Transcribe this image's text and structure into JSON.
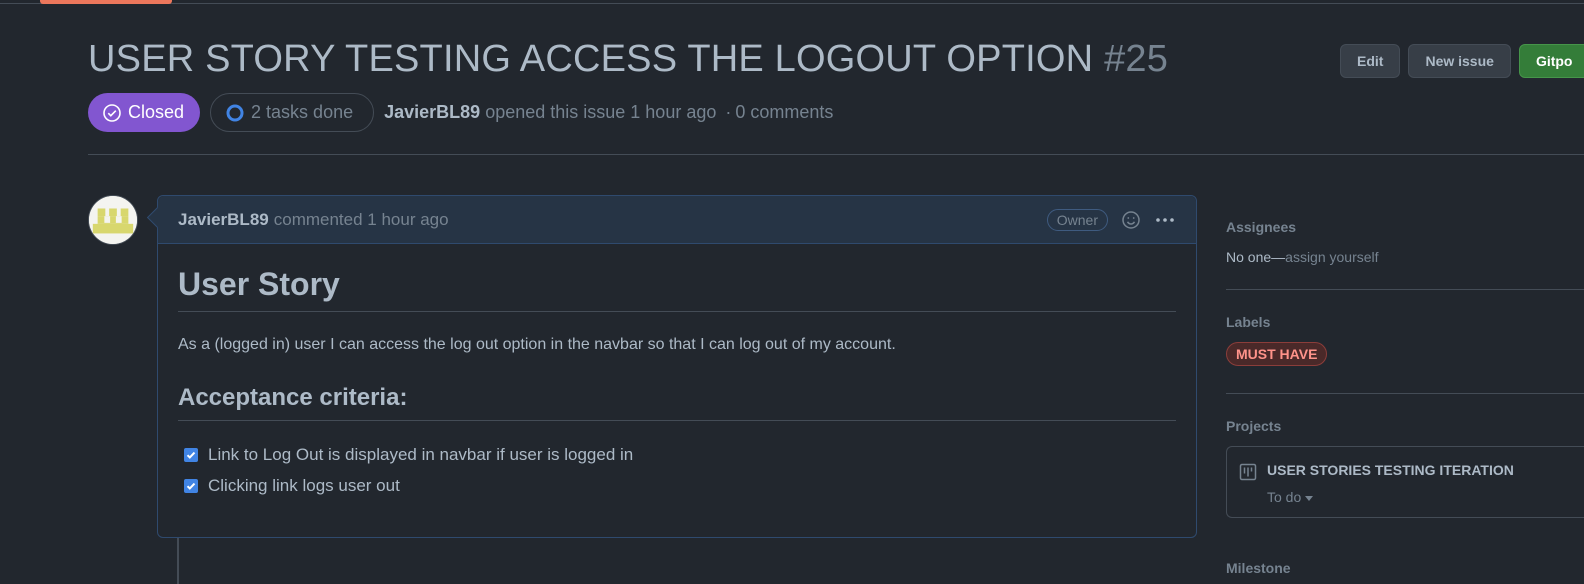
{
  "issue": {
    "title": "USER STORY TESTING ACCESS THE LOGOUT OPTION",
    "number": "#25",
    "state": "Closed",
    "tasks": "2 tasks done",
    "author": "JavierBL89",
    "opened_text": "opened this issue 1 hour ago",
    "separator": "·",
    "comments": "0 comments"
  },
  "header_actions": {
    "edit": "Edit",
    "new_issue": "New issue",
    "gitpod": "Gitpo"
  },
  "comment": {
    "author": "JavierBL89",
    "action": "commented 1 hour ago",
    "role": "Owner",
    "heading": "User Story",
    "paragraph": "As a (logged in) user I can access the log out option in the navbar so that I can log out of my account.",
    "subheading": "Acceptance criteria:",
    "tasks": [
      {
        "label": "Link to Log Out is displayed in navbar if user is logged in",
        "checked": true
      },
      {
        "label": "Clicking link logs user out",
        "checked": true
      }
    ]
  },
  "sidebar": {
    "assignees_title": "Assignees",
    "assignees_value": "No one—",
    "assignees_link": "assign yourself",
    "labels_title": "Labels",
    "label": "MUST HAVE",
    "projects_title": "Projects",
    "project_name": "USER STORIES TESTING ITERATION",
    "project_status": "To do",
    "milestone_title": "Milestone"
  },
  "colors": {
    "background": "#22272e",
    "closed_badge": "#8256d0",
    "green_button": "#347d39",
    "label_text": "#ff938a",
    "checkbox": "#4184e4"
  }
}
